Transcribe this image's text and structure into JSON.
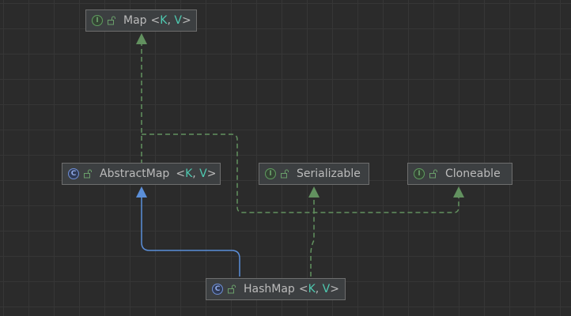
{
  "diagram": {
    "nodes": {
      "map": {
        "kind": "interface",
        "kind_icon": "interface-icon",
        "name": "Map",
        "open": "<",
        "p1": "K",
        "sep": ", ",
        "p2": "V",
        "close": ">"
      },
      "abstract_map": {
        "kind": "class",
        "kind_icon": "abstract-class-icon",
        "name": "AbstractMap",
        "open": "<",
        "p1": "K",
        "sep": ", ",
        "p2": "V",
        "close": ">"
      },
      "serializable": {
        "kind": "interface",
        "kind_icon": "interface-icon",
        "name": "Serializable"
      },
      "cloneable": {
        "kind": "interface",
        "kind_icon": "interface-icon",
        "name": "Cloneable"
      },
      "hash_map": {
        "kind": "class",
        "kind_icon": "class-icon",
        "name": "HashMap",
        "open": "<",
        "p1": "K",
        "sep": ", ",
        "p2": "V",
        "close": ">"
      }
    },
    "edges": [
      {
        "from": "abstract_map",
        "to": "map",
        "type": "implements"
      },
      {
        "from": "abstract_map",
        "to": "serializable",
        "type": "implements"
      },
      {
        "from": "abstract_map",
        "to": "cloneable",
        "type": "implements"
      },
      {
        "from": "hash_map",
        "to": "abstract_map",
        "type": "extends"
      },
      {
        "from": "hash_map",
        "to": "serializable",
        "type": "implements"
      }
    ],
    "colors": {
      "background": "#2b2b2b",
      "node_fill": "#3c3f41",
      "implements_edge": "#62915f",
      "extends_edge": "#5b8fd9",
      "type_param": "#4ec9b0"
    }
  }
}
